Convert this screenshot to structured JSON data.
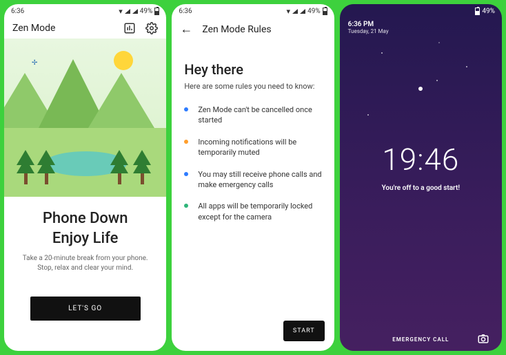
{
  "status": {
    "time": "6:36",
    "battery": "49%"
  },
  "screen1": {
    "title": "Zen Mode",
    "headline1": "Phone Down",
    "headline2": "Enjoy Life",
    "sub": "Take a 20-minute break from your phone. Stop, relax and clear your mind.",
    "cta": "LET'S GO"
  },
  "screen2": {
    "title": "Zen Mode Rules",
    "heading": "Hey there",
    "sub": "Here are some rules you need to know:",
    "rules": [
      {
        "color": "#2e7cff",
        "text": "Zen Mode can't be cancelled once started"
      },
      {
        "color": "#ff9e2c",
        "text": "Incoming notifications will be temporarily muted"
      },
      {
        "color": "#2e7cff",
        "text": "You may still receive phone calls and make emergency calls"
      },
      {
        "color": "#2fb57a",
        "text": "All apps will be temporarily locked except for the camera"
      }
    ],
    "start": "START"
  },
  "screen3": {
    "clock": "6:36 PM",
    "date": "Tuesday, 21 May",
    "battery": "49%",
    "countdown": "19:46",
    "message": "You're off to a good start!",
    "emergency": "EMERGENCY CALL"
  }
}
